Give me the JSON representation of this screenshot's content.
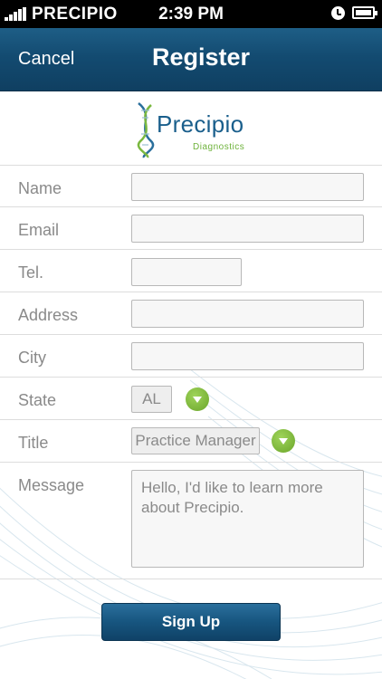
{
  "status_bar": {
    "carrier": "PRECIPIO",
    "time": "2:39 PM"
  },
  "nav": {
    "cancel_label": "Cancel",
    "title": "Register"
  },
  "logo": {
    "name": "Precipio",
    "subtitle": "Diagnostics"
  },
  "form": {
    "name_label": "Name",
    "email_label": "Email",
    "tel_label": "Tel.",
    "address_label": "Address",
    "city_label": "City",
    "state_label": "State",
    "state_value": "AL",
    "title_label": "Title",
    "title_value": "Practice Manager",
    "message_label": "Message",
    "message_value": "Hello, I'd like to learn more about Precipio."
  },
  "signup_label": "Sign Up",
  "colors": {
    "nav_bar": "#134b71",
    "accent_green": "#6aa52a",
    "logo_blue": "#1a5f8c"
  }
}
